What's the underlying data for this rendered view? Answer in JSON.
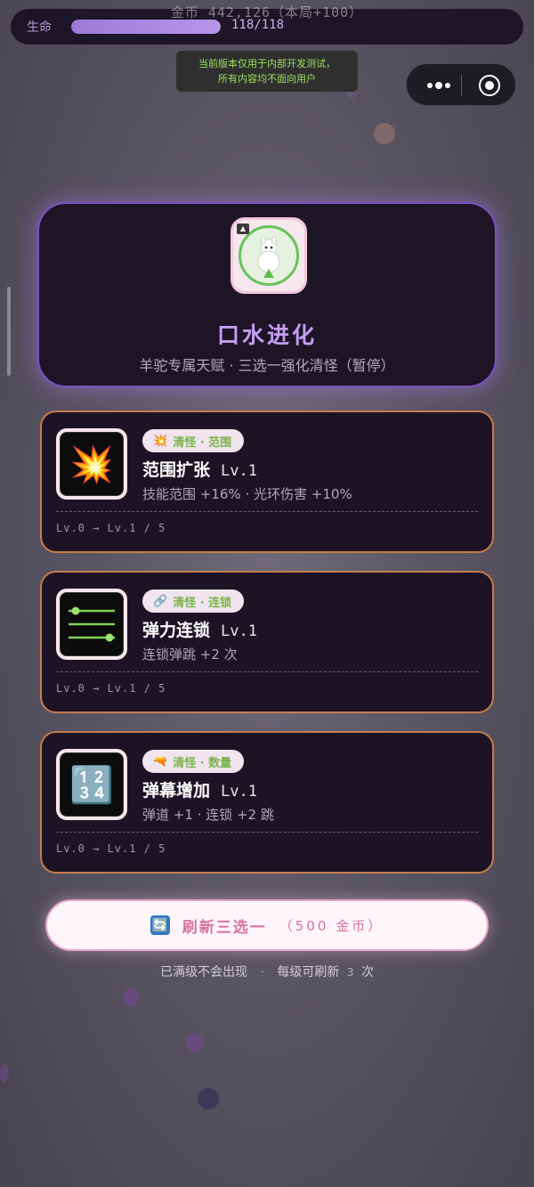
{
  "hud": {
    "coins_text": "金币 442,126（本局+100）",
    "hp_label": "生命",
    "hp_text": "118/118",
    "hp_fraction": 1.0
  },
  "notice": {
    "line1": "当前版本仅用于内部开发测试，",
    "line2": "所有内容均不面向用户"
  },
  "capsule": {
    "more_icon": "more-dots-icon",
    "close_icon": "target-circle-icon"
  },
  "header": {
    "title": "口水进化",
    "subtitle": "羊驼专属天赋 · 三选一强化清怪（暂停）"
  },
  "options": [
    {
      "tag_icon": "💥",
      "tag": "清怪 · 范围",
      "title": "范围扩张",
      "level": "Lv.1",
      "desc": "技能范围 +16% · 光环伤害 +10%",
      "progress": "Lv.0 → Lv.1 / 5",
      "icon": "explosion-icon",
      "icon_glyph": "💥"
    },
    {
      "tag_icon": "🔗",
      "tag": "清怪 · 连锁",
      "title": "弹力连锁",
      "level": "Lv.1",
      "desc": "连锁弹跳 +2 次",
      "progress": "Lv.0 → Lv.1 / 5",
      "icon": "sliders-icon"
    },
    {
      "tag_icon": "🔫",
      "tag": "清怪 · 数量",
      "title": "弹幕增加",
      "level": "Lv.1",
      "desc": "弹道 +1 · 连锁 +2 跳",
      "progress": "Lv.0 → Lv.1 / 5",
      "icon": "numbers-1234-icon",
      "icon_glyph": "🔢"
    }
  ],
  "refresh": {
    "icon_glyph": "🔄",
    "label": "刷新三选一",
    "cost": "（500 金币）"
  },
  "footer": {
    "left": "已满级不会出现",
    "sep": "·",
    "right_a": "每级可刷新",
    "right_num": "3",
    "right_b": "次"
  },
  "colors": {
    "accent_purple": "#c79df2",
    "card_border": "#c67d4c",
    "tag_text": "#7ab54a",
    "refresh_text": "#d9739f"
  }
}
